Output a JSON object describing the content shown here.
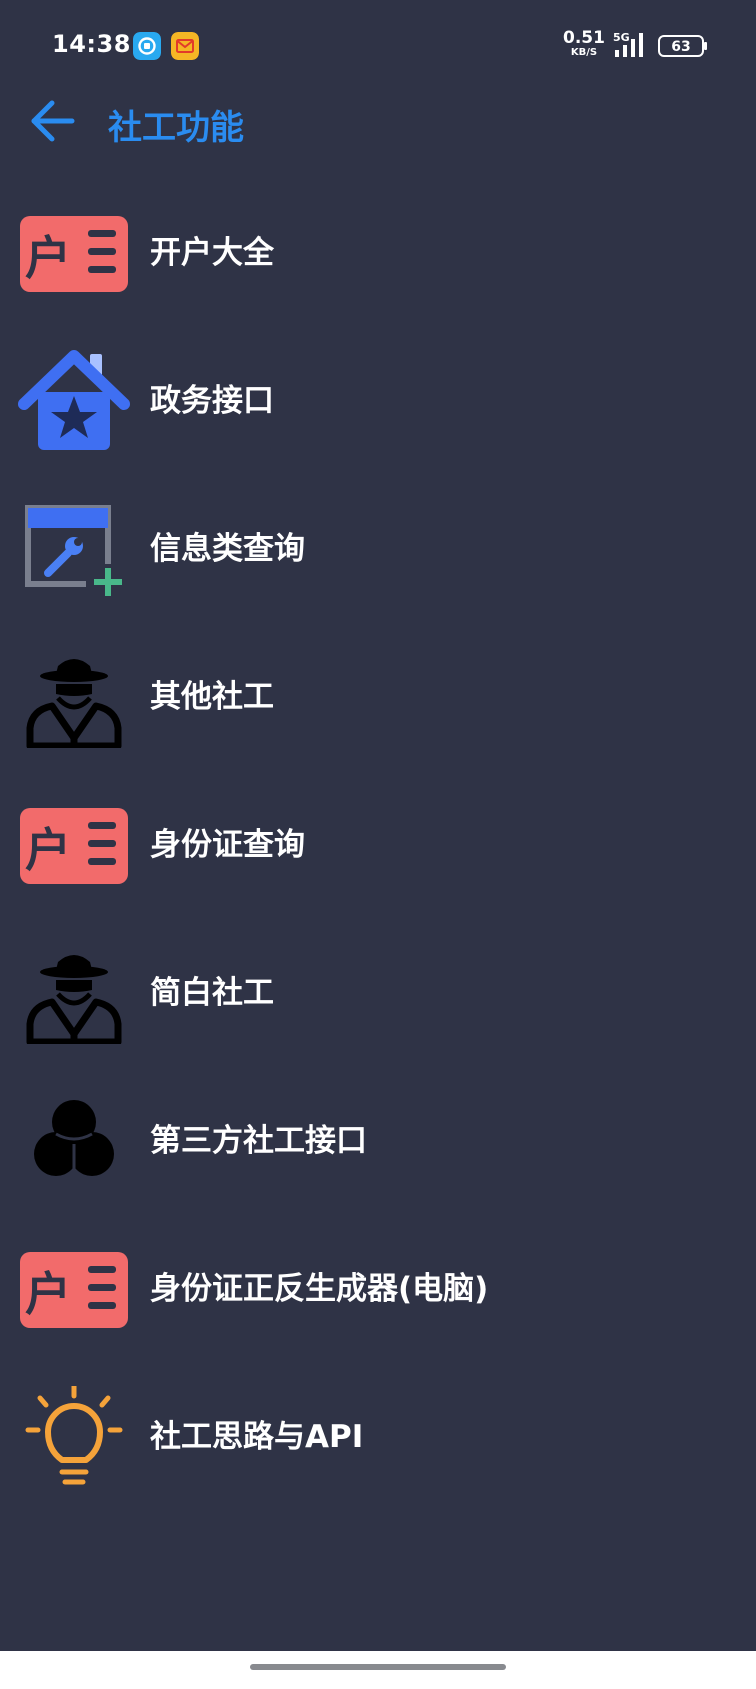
{
  "status_bar": {
    "time": "14:38",
    "net_speed_value": "0.51",
    "net_speed_unit": "KB/S",
    "network_type": "5G",
    "battery": "63"
  },
  "header": {
    "title": "社工功能"
  },
  "menu": {
    "items": [
      {
        "label": "开户大全",
        "icon": "household-register-icon"
      },
      {
        "label": "政务接口",
        "icon": "house-star-icon"
      },
      {
        "label": "信息类查询",
        "icon": "wrench-window-add-icon"
      },
      {
        "label": "其他社工",
        "icon": "spy-agent-icon"
      },
      {
        "label": "身份证查询",
        "icon": "household-register-icon"
      },
      {
        "label": "简白社工",
        "icon": "spy-agent-icon"
      },
      {
        "label": "第三方社工接口",
        "icon": "three-circles-icon"
      },
      {
        "label": "身份证正反生成器(电脑)",
        "icon": "household-register-icon"
      },
      {
        "label": "社工思路与API",
        "icon": "lightbulb-icon"
      }
    ]
  },
  "colors": {
    "background": "#2f3346",
    "accent": "#2a8cf0",
    "register_icon": "#f26b6b",
    "house_icon": "#3f6ff2",
    "bulb_icon": "#f5a33a",
    "add_plus": "#49b88a"
  },
  "household_glyph": "户"
}
